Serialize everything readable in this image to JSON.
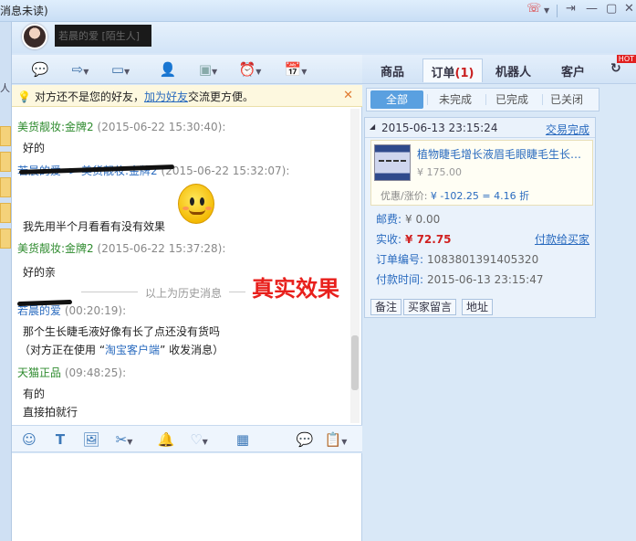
{
  "titlebar": {
    "unread_text": "消息未读)"
  },
  "profile": {
    "nickname": "若晨的爱 [陌生人]"
  },
  "leftstrip": {
    "label": "人"
  },
  "notice": {
    "prefix": "对方还不是您的好友，",
    "link": "加为好友",
    "suffix": "交流更方便。"
  },
  "messages": [
    {
      "sender": "美货靓妆:金牌2",
      "time": "(2015-06-22 15:30:40):",
      "lines": [
        "好的"
      ]
    },
    {
      "sender": "若晨的爱 -> 美货靓妆:金牌2",
      "time": "(2015-06-22 15:32:07):",
      "lines": [
        "我先用半个月看看有没有效果"
      ]
    },
    {
      "sender": "美货靓妆:金牌2",
      "time": "(2015-06-22 15:37:28):",
      "lines": [
        "好的亲"
      ]
    },
    {
      "sender": "若晨的爱",
      "time": "(00:20:19):",
      "lines": [
        "那个生长睫毛液好像有长了点还没有货吗"
      ],
      "note_prefix": "（对方正在使用 “",
      "note_link": "淘宝客户端",
      "note_suffix": "” 收发消息）"
    },
    {
      "sender": "天猫正品",
      "time": "(09:48:25):",
      "lines": [
        "有的",
        "直接拍就行"
      ]
    }
  ],
  "history_divider": "以上为历史消息",
  "stamp_text": "真实效果",
  "right": {
    "tabs": [
      {
        "label": "商品"
      },
      {
        "label": "订单",
        "count": "(1)"
      },
      {
        "label": "机器人"
      },
      {
        "label": "客户"
      }
    ],
    "hot_badge": "HOT",
    "filters": [
      "全部",
      "未完成",
      "已完成",
      "已关闭"
    ],
    "order": {
      "date": "2015-06-13 23:15:24",
      "status": "交易完成",
      "item_name": "植物睫毛增长液眉毛眼睫毛生长…",
      "item_price": "¥ 175.00",
      "discount_label": "优惠/涨价:",
      "discount_value": "¥ -102.25 = 4.16 折",
      "postage_label": "邮费:",
      "postage_value": "¥ 0.00",
      "paid_label": "实收:",
      "paid_value": "¥ 72.75",
      "pay_to_seller": "付款给买家",
      "order_no_label": "订单编号:",
      "order_no_value": "1083801391405320",
      "pay_time_label": "付款时间:",
      "pay_time_value": "2015-06-13 23:15:47",
      "buttons": [
        "备注",
        "买家留言",
        "地址"
      ]
    }
  },
  "icons": {
    "toolbar": [
      "chat-bubble-icon",
      "transfer-icon",
      "video-icon",
      "add-user-icon",
      "screen-share-icon",
      "alarm-icon",
      "calendar-add-icon"
    ],
    "inputbar": [
      "emoji-icon",
      "font-icon",
      "image-icon",
      "scissors-icon",
      "bell-icon",
      "heart-icon",
      "calculator-icon",
      "quick-reply-icon",
      "history-icon"
    ]
  }
}
